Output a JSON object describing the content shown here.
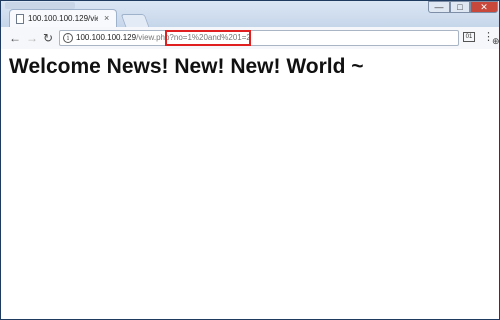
{
  "tab": {
    "title": "100.100.100.129/view.ph",
    "close": "×"
  },
  "window_controls": {
    "minimize": "—",
    "maximize": "□",
    "close": "✕"
  },
  "address_bar": {
    "host": "100.100.100.129",
    "path": "/view.php",
    "query": "?no=1%20and%201=2"
  },
  "icons": {
    "back": "back-arrow-icon",
    "forward": "forward-arrow-icon",
    "reload": "reload-icon",
    "info": "info-icon",
    "zoom": "zoom-icon",
    "bookmark": "star-icon",
    "extension": "extension-icon",
    "menu": "kebab-menu-icon"
  },
  "highlight_color": "#e02020",
  "page": {
    "headline": "Welcome News! New! New! World ~"
  }
}
